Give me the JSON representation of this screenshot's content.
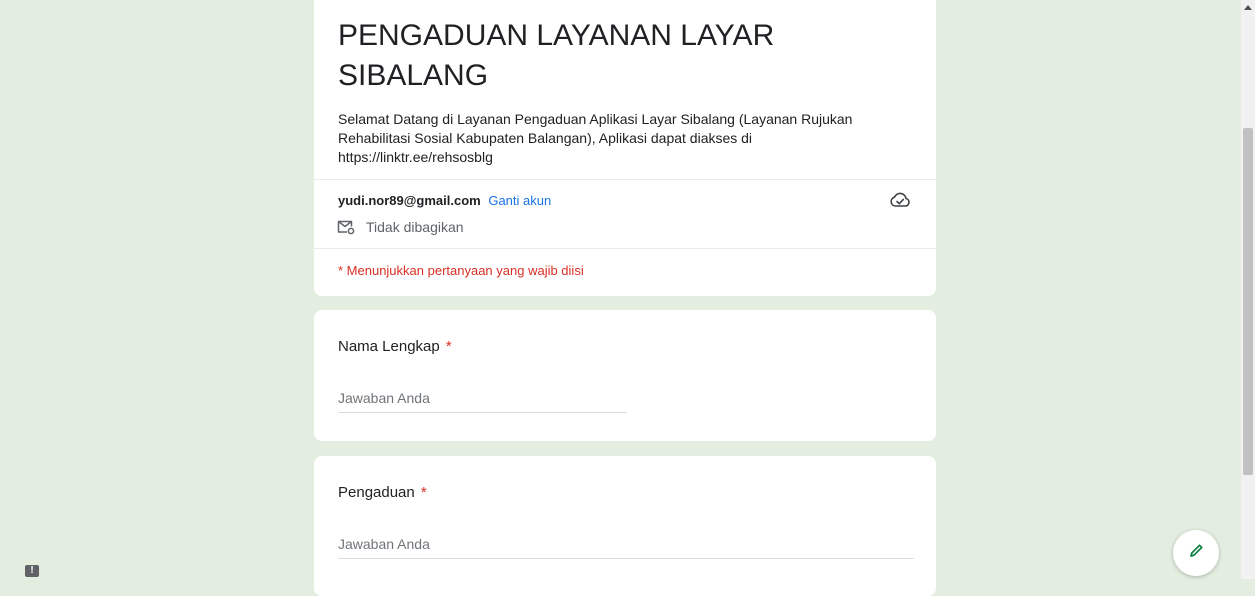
{
  "form": {
    "title": "PENGADUAN LAYANAN LAYAR SIBALANG",
    "description": "Selamat Datang di Layanan Pengaduan Aplikasi Layar Sibalang (Layanan Rujukan Rehabilitasi Sosial Kabupaten Balangan), Aplikasi dapat diakses di https://linktr.ee/rehsosblg",
    "account_email": "yudi.nor89@gmail.com",
    "switch_account_label": "Ganti akun",
    "not_shared_label": "Tidak dibagikan",
    "required_note": "* Menunjukkan pertanyaan yang wajib diisi"
  },
  "questions": [
    {
      "label": "Nama Lengkap",
      "required_mark": "*",
      "value": "",
      "placeholder": "Jawaban Anda"
    },
    {
      "label": "Pengaduan",
      "required_mark": "*",
      "value": "",
      "placeholder": "Jawaban Anda"
    }
  ],
  "icons": {
    "cloud": "cloud-check-icon",
    "mail": "mail-settings-icon",
    "report": "report-icon",
    "edit": "pencil-icon"
  },
  "report_glyph": "!",
  "colors": {
    "background": "#e3eee0",
    "required_red": "#d93025",
    "link_blue": "#1a73e8",
    "fab_icon_green": "#0b8043"
  }
}
